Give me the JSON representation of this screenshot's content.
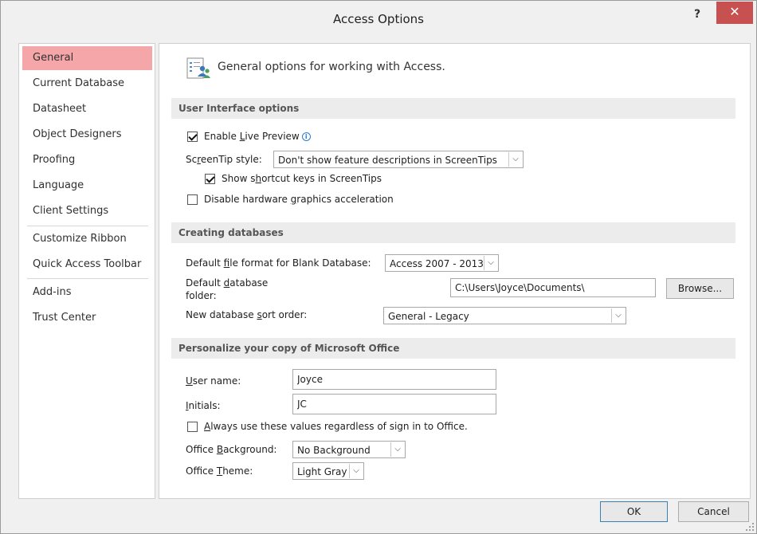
{
  "window": {
    "title": "Access Options",
    "help_label": "?",
    "close_label": "✕"
  },
  "nav": {
    "items": [
      {
        "label": "General"
      },
      {
        "label": "Current Database"
      },
      {
        "label": "Datasheet"
      },
      {
        "label": "Object Designers"
      },
      {
        "label": "Proofing"
      },
      {
        "label": "Language"
      },
      {
        "label": "Client Settings"
      },
      {
        "label": "Customize Ribbon"
      },
      {
        "label": "Quick Access Toolbar"
      },
      {
        "label": "Add-ins"
      },
      {
        "label": "Trust Center"
      }
    ],
    "active": "General"
  },
  "header": {
    "text": "General options for working with Access.",
    "icon": "general-options-icon"
  },
  "sections": {
    "ui": {
      "title": "User Interface options",
      "live_preview": {
        "pre": "Enable ",
        "key": "L",
        "post": "ive Preview",
        "checked": true
      },
      "screentip_label": {
        "pre": "Sc",
        "key": "r",
        "post": "eenTip style:"
      },
      "screentip_value": "Don't show feature descriptions in ScreenTips",
      "shortcut_keys": {
        "pre": "Show s",
        "key": "h",
        "post": "ortcut keys in ScreenTips",
        "checked": true
      },
      "hw_accel": {
        "pre": "Disable hardware ",
        "key": "g",
        "post": "raphics acceleration",
        "checked": false
      }
    },
    "db": {
      "title": "Creating databases",
      "format_label": {
        "pre": "Default ",
        "key": "f",
        "post": "ile format for Blank Database:"
      },
      "format_value": "Access 2007 - 2013",
      "folder_label_line1": {
        "pre": "Default ",
        "key": "d",
        "post": "atabase"
      },
      "folder_label_line2": "folder:",
      "folder_value": "C:\\Users\\Joyce\\Documents\\",
      "browse_label": "Browse...",
      "sort_label": {
        "pre": "New database ",
        "key": "s",
        "post": "ort order:"
      },
      "sort_value": "General - Legacy"
    },
    "personalize": {
      "title": "Personalize your copy of Microsoft Office",
      "username_label": {
        "pre": "",
        "key": "U",
        "post": "ser name:"
      },
      "username_value": "Joyce",
      "initials_label": {
        "pre": "",
        "key": "I",
        "post": "nitials:"
      },
      "initials_value": "JC",
      "always_use": {
        "pre": "",
        "key": "A",
        "post": "lways use these values regardless of sign in to Office.",
        "checked": false
      },
      "bg_label": {
        "pre": "Office ",
        "key": "B",
        "post": "ackground:"
      },
      "bg_value": "No Background",
      "theme_label": {
        "pre": "Office ",
        "key": "T",
        "post": "heme:"
      },
      "theme_value": "Light Gray"
    }
  },
  "footer": {
    "ok_label": "OK",
    "cancel_label": "Cancel"
  },
  "colors": {
    "active_nav": "#f4a6a8",
    "close_button": "#c75050",
    "section_band": "#ececec"
  }
}
